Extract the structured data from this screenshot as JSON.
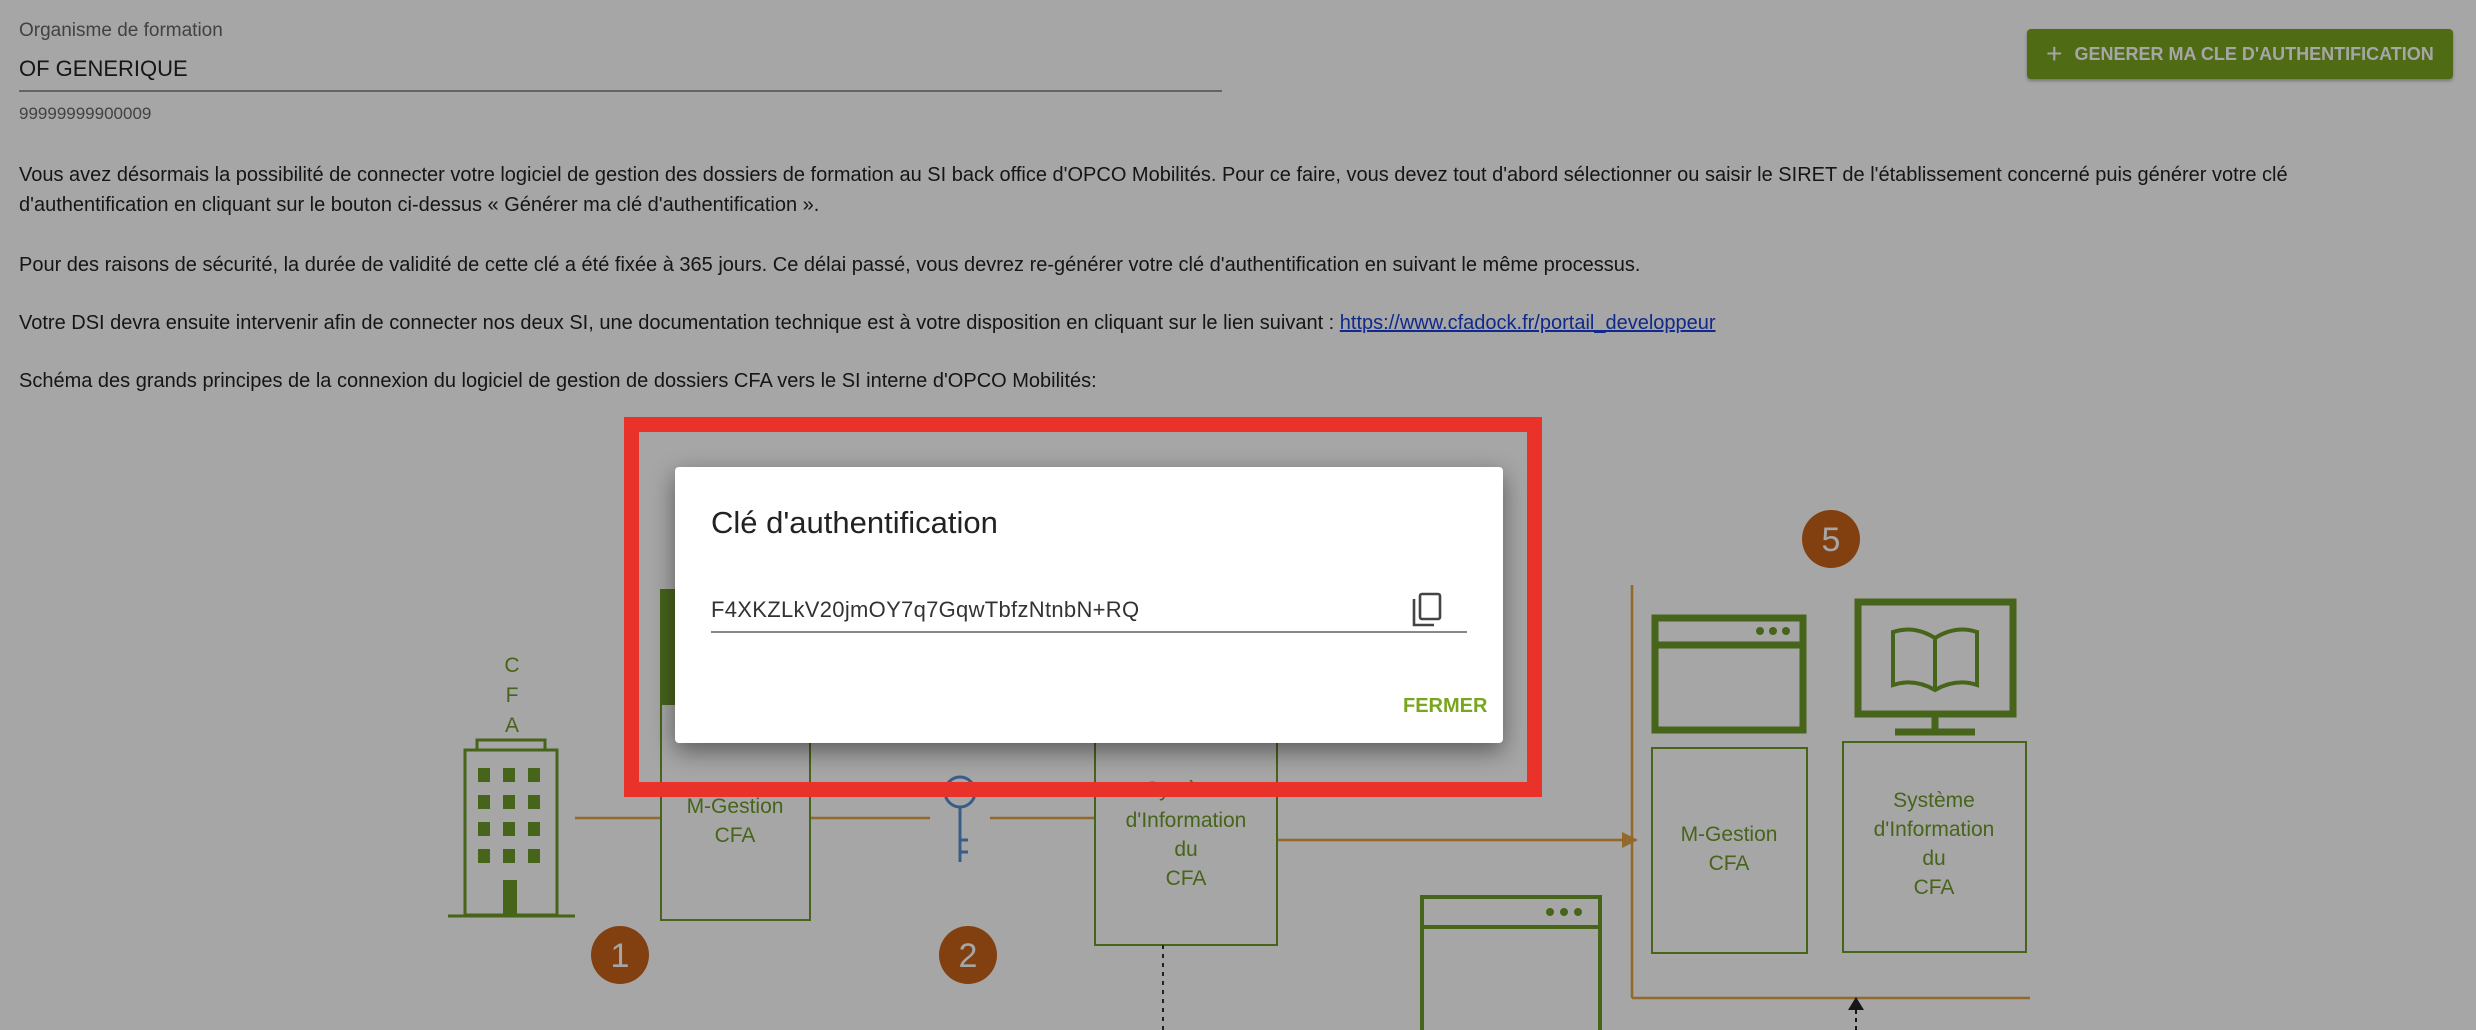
{
  "form": {
    "org_label": "Organisme de formation",
    "org_value": "OF GENERIQUE",
    "siret": "99999999900009"
  },
  "toolbar": {
    "generate_label": "GENERER MA CLE D'AUTHENTIFICATION"
  },
  "intro": {
    "paragraph1": "Vous avez désormais la possibilité de connecter votre logiciel de gestion des dossiers de formation au SI back office d'OPCO Mobilités. Pour ce faire, vous devez tout d'abord sélectionner ou saisir le SIRET de l'établissement concerné puis générer votre clé d'authentification en cliquant sur le bouton ci-dessus « Générer ma clé d'authentification ».",
    "paragraph2": "Pour des raisons de sécurité, la durée de validité de cette clé a été fixée à 365 jours. Ce délai passé, vous devrez re-générer votre clé d'authentification en suivant le même processus.",
    "paragraph3_prefix": "Votre DSI devra ensuite intervenir afin de connecter nos deux SI, une documentation technique est à votre disposition en cliquant sur le lien suivant : ",
    "doc_link": "https://www.cfadock.fr/portail_developpeur",
    "paragraph4": "Schéma des grands principes de la connexion du logiciel de gestion de dossiers CFA vers le SI interne d'OPCO Mobilités:"
  },
  "diagram": {
    "cfa_vertical": [
      "C",
      "F",
      "A"
    ],
    "box_mgestion_left": [
      "M-Gestion",
      "CFA"
    ],
    "box_si_center": [
      "Système",
      "d'Information",
      "du",
      "CFA"
    ],
    "box_mgestion_right": [
      "M-Gestion",
      "CFA"
    ],
    "box_si_right": [
      "Système",
      "d'Information",
      "du",
      "CFA"
    ],
    "step_numbers": [
      "1",
      "2",
      "5"
    ],
    "accent_orange": "#c8621a",
    "accent_green": "#6e9a2a"
  },
  "dialog": {
    "title": "Clé d'authentification",
    "key_value": "F4XKZLkV20jmOY7q7GqwTbfzNtnbN+RQ",
    "close_label": "FERMER"
  },
  "colors": {
    "brand_green": "#7aa51f",
    "highlight_red": "#e8322a",
    "link_blue": "#1a3fd6"
  }
}
